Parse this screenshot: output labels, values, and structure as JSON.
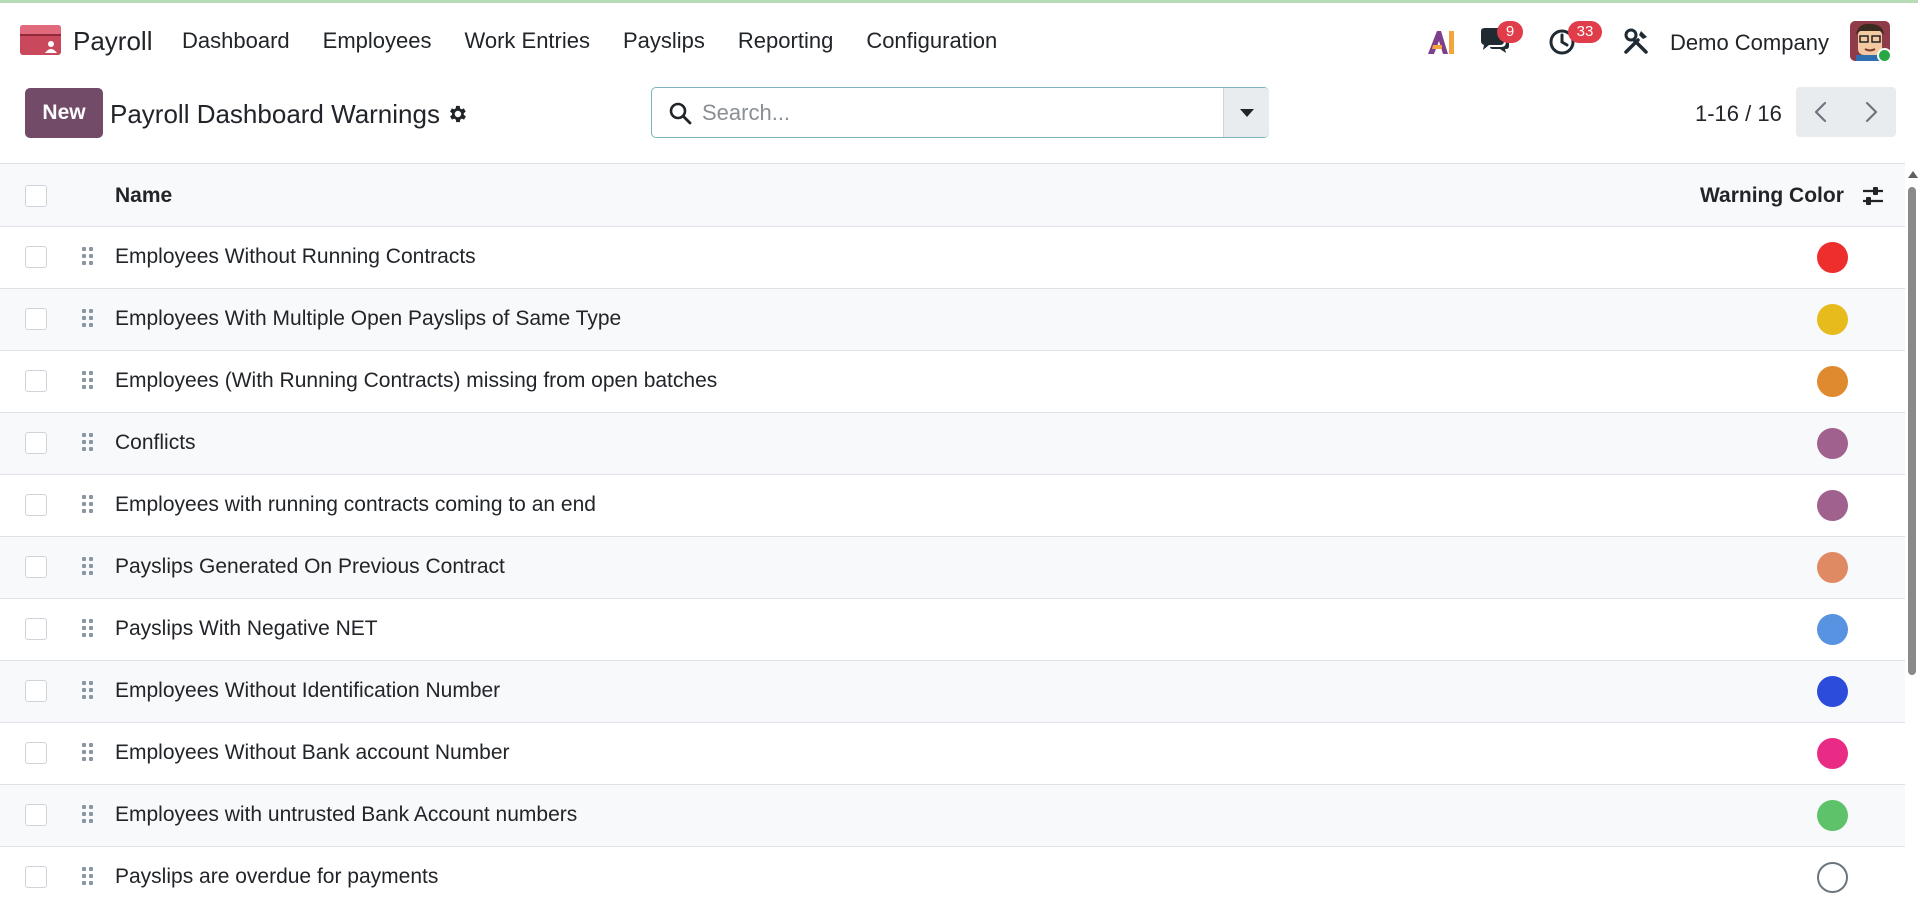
{
  "app": {
    "name": "Payroll",
    "menu": [
      "Dashboard",
      "Employees",
      "Work Entries",
      "Payslips",
      "Reporting",
      "Configuration"
    ]
  },
  "systray": {
    "ai_label": "AI",
    "messages_count": "9",
    "activities_count": "33",
    "company": "Demo Company"
  },
  "control": {
    "new_label": "New",
    "title": "Payroll Dashboard Warnings",
    "search_placeholder": "Search...",
    "pager": "1-16 / 16"
  },
  "table": {
    "columns": {
      "name": "Name",
      "warning_color": "Warning Color"
    },
    "rows": [
      {
        "name": "Employees Without Running Contracts",
        "color": "#ee2d2d"
      },
      {
        "name": "Employees With Multiple Open Payslips of Same Type",
        "color": "#e8bb1d"
      },
      {
        "name": "Employees (With Running Contracts) missing from open batches",
        "color": "#e08a2f"
      },
      {
        "name": "Conflicts",
        "color": "#a0618f"
      },
      {
        "name": "Employees with running contracts coming to an end",
        "color": "#a0618f"
      },
      {
        "name": "Payslips Generated On Previous Contract",
        "color": "#df8a63"
      },
      {
        "name": "Payslips With Negative NET",
        "color": "#5793e0"
      },
      {
        "name": "Employees Without Identification Number",
        "color": "#2c4cdc"
      },
      {
        "name": "Employees Without Bank account Number",
        "color": "#ea2b85"
      },
      {
        "name": "Employees with untrusted Bank Account numbers",
        "color": "#5ec26a"
      },
      {
        "name": "Payslips are overdue for payments",
        "color": ""
      }
    ]
  },
  "colors": {
    "brand": "#714b67",
    "badge": "#e03c4a",
    "online": "#28a745"
  }
}
